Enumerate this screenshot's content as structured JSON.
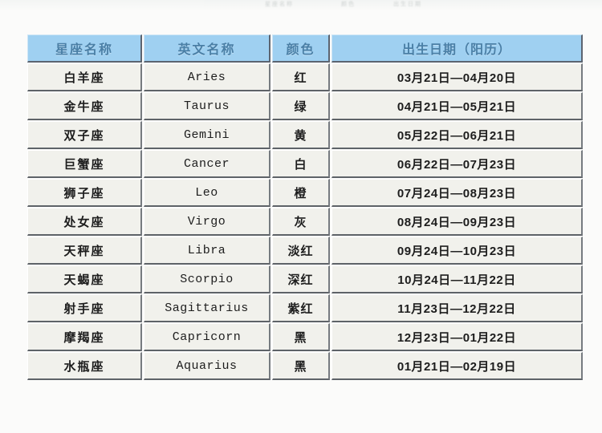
{
  "table": {
    "headers": {
      "name": "星座名称",
      "english": "英文名称",
      "color": "颜色",
      "birthdate": "出生日期（阳历）"
    },
    "rows": [
      {
        "name": "白羊座",
        "english": "Aries",
        "color": "红",
        "birthdate": "03月21日—04月20日"
      },
      {
        "name": "金牛座",
        "english": "Taurus",
        "color": "绿",
        "birthdate": "04月21日—05月21日"
      },
      {
        "name": "双子座",
        "english": "Gemini",
        "color": "黄",
        "birthdate": "05月22日—06月21日"
      },
      {
        "name": "巨蟹座",
        "english": "Cancer",
        "color": "白",
        "birthdate": "06月22日—07月23日"
      },
      {
        "name": "狮子座",
        "english": "Leo",
        "color": "橙",
        "birthdate": "07月24日—08月23日"
      },
      {
        "name": "处女座",
        "english": "Virgo",
        "color": "灰",
        "birthdate": "08月24日—09月23日"
      },
      {
        "name": "天秤座",
        "english": "Libra",
        "color": "淡红",
        "birthdate": "09月24日—10月23日"
      },
      {
        "name": "天蝎座",
        "english": "Scorpio",
        "color": "深红",
        "birthdate": "10月24日—11月22日"
      },
      {
        "name": "射手座",
        "english": "Sagittarius",
        "color": "紫红",
        "birthdate": "11月23日—12月22日"
      },
      {
        "name": "摩羯座",
        "english": "Capricorn",
        "color": "黑",
        "birthdate": "12月23日—01月22日"
      },
      {
        "name": "水瓶座",
        "english": "Aquarius",
        "color": "黑",
        "birthdate": "01月21日—02月19日"
      }
    ]
  },
  "theme": {
    "header_bg": "#9fd0f1",
    "header_text": "#4a7fa6",
    "cell_bg": "#f1f1ec",
    "cell_text": "#1d1d1d",
    "border_dark": "#5e6368",
    "page_bg": "#fbfbfa"
  }
}
